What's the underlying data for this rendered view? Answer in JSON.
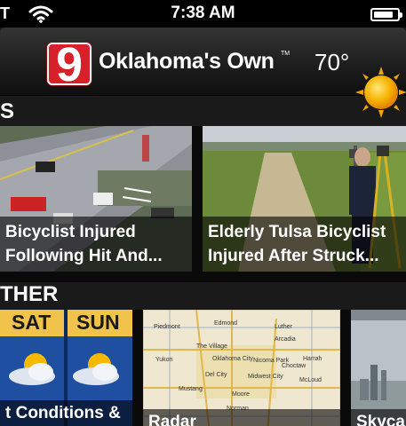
{
  "status_bar": {
    "carrier": "T",
    "time": "7:38 AM",
    "battery_level": 0.85
  },
  "header": {
    "logo_number": "9",
    "brand_name": "Oklahoma's Own",
    "trademark": "TM",
    "temperature": "70°",
    "weather_icon": "sun-icon"
  },
  "news": {
    "title": "S",
    "stories": [
      {
        "line1": "Bicyclist Injured",
        "line2": "Following Hit And..."
      },
      {
        "line1": "Elderly Tulsa Bicyclist",
        "line2": "Injured After Struck..."
      }
    ]
  },
  "weather": {
    "title": "THER",
    "forecast_days": [
      "SAT",
      "SUN"
    ],
    "tiles": [
      {
        "label": "t Conditions &"
      },
      {
        "label": "Radar",
        "map_labels": [
          "Edmond",
          "Piedmont",
          "Luther",
          "Arcadia",
          "The Village",
          "Yukon",
          "Oklahoma City",
          "Nicoma Park",
          "Choctaw",
          "Harrah",
          "Del City",
          "Midwest City",
          "McLoud",
          "Mustang",
          "Moore",
          "Norman"
        ]
      },
      {
        "label": "Skyca"
      }
    ]
  },
  "colors": {
    "logo_red": "#d8202a",
    "header_bg": "#1e1e1e",
    "sun_yellow": "#f7b500",
    "forecast_gold": "#f2c34a"
  }
}
